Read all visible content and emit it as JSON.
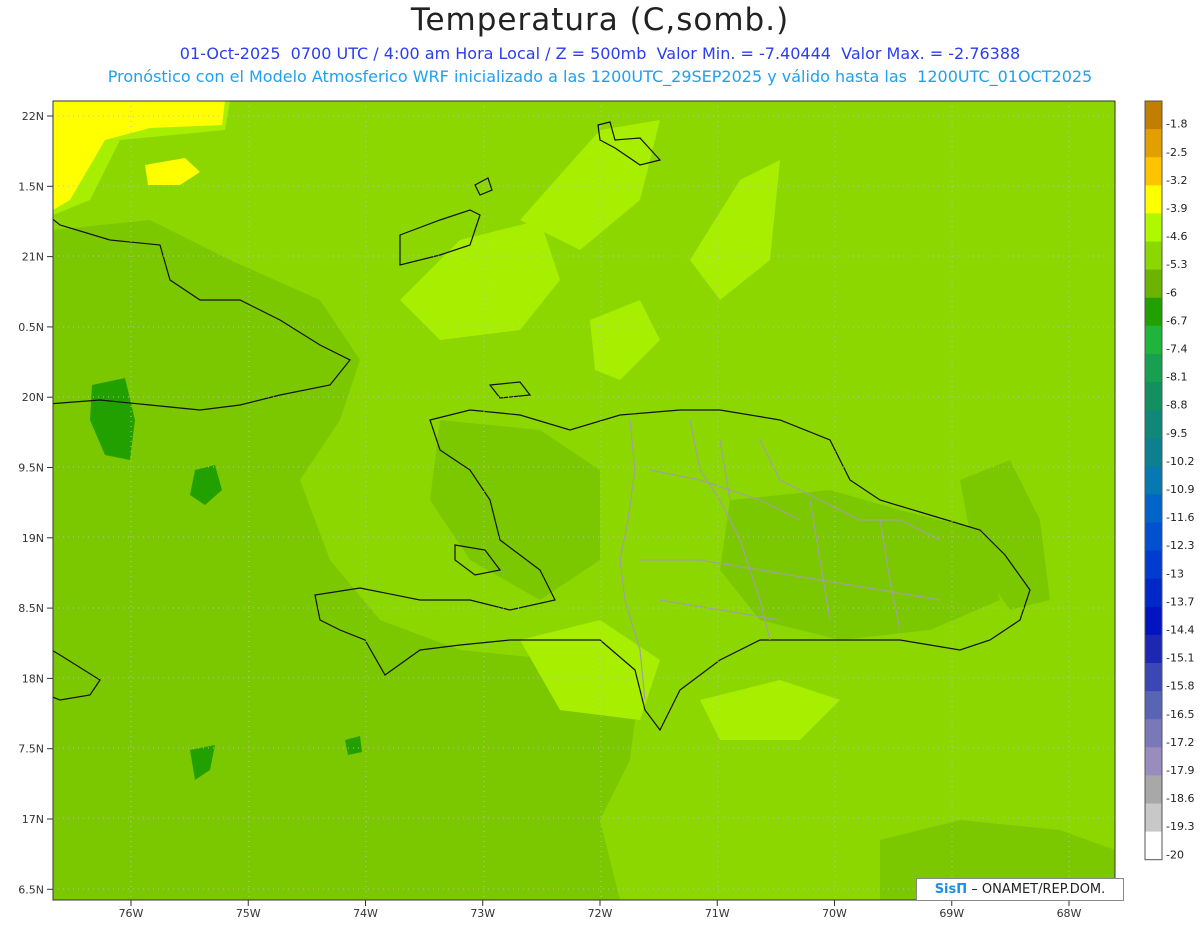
{
  "header": {
    "title": "Temperatura (C,somb.)",
    "subtitle1": "01-Oct-2025  0700 UTC / 4:00 am Hora Local / Z = 500mb  Valor Min. = -7.40444  Valor Max. = -2.76388",
    "subtitle2": "Pronóstico con el Modelo Atmosferico WRF inicializado a las 1200UTC_29SEP2025 y válido hasta las  1200UTC_01OCT2025"
  },
  "map": {
    "lat_ticks": [
      "22N",
      "1.5N",
      "21N",
      "0.5N",
      "20N",
      "9.5N",
      "19N",
      "8.5N",
      "18N",
      "7.5N",
      "17N",
      "6.5N"
    ],
    "lon_ticks": [
      "76W",
      "75W",
      "74W",
      "73W",
      "72W",
      "71W",
      "70W",
      "69W",
      "68W"
    ]
  },
  "colorbar": {
    "labels": [
      "-1.8",
      "-2.5",
      "-3.2",
      "-3.9",
      "-4.6",
      "-5.3",
      "-6",
      "-6.7",
      "-7.4",
      "-8.1",
      "-8.8",
      "-9.5",
      "-10.2",
      "-10.9",
      "-11.6",
      "-12.3",
      "-13",
      "-13.7",
      "-14.4",
      "-15.1",
      "-15.8",
      "-16.5",
      "-17.2",
      "-17.9",
      "-18.6",
      "-19.3",
      "-20"
    ],
    "colors": [
      "#c07f00",
      "#e1a000",
      "#ffc400",
      "#ffff00",
      "#aef800",
      "#8cd700",
      "#6cb400",
      "#22a000",
      "#1fb43c",
      "#18a050",
      "#129060",
      "#108878",
      "#0d8090",
      "#0878b0",
      "#0064c8",
      "#0050d0",
      "#003cd0",
      "#0028c8",
      "#0014c0",
      "#1c28b4",
      "#3c46b4",
      "#5a64b4",
      "#7a78b8",
      "#9a8cbc",
      "#a8a8a8",
      "#c8c8c8",
      "#ffffff"
    ]
  },
  "credit": {
    "brand": "SisΠ",
    "text": "– ONAMET/REP.DOM."
  }
}
